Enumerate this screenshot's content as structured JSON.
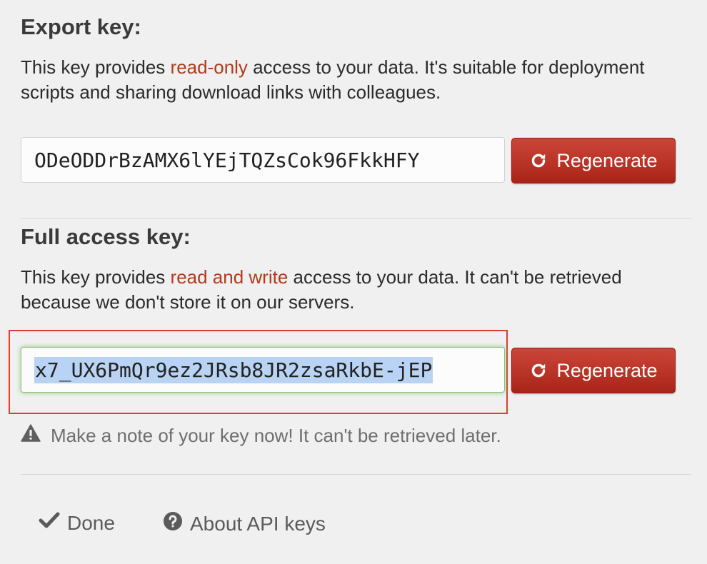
{
  "export_key": {
    "title": "Export key:",
    "desc_before": "This key provides ",
    "desc_highlight": "read-only",
    "desc_after": " access to your data. It's suitable for deployment scripts and sharing download links with colleagues.",
    "value": "ODeODDrBzAMX6lYEjTQZsCok96FkkHFY",
    "regenerate_label": "Regenerate"
  },
  "full_access_key": {
    "title": "Full access key:",
    "desc_before": "This key provides ",
    "desc_highlight": "read and write",
    "desc_after": " access to your data. It can't be retrieved because we don't store it on our servers.",
    "value": "x7_UX6PmQr9ez2JRsb8JR2zsaRkbE-jEP",
    "regenerate_label": "Regenerate"
  },
  "warning": {
    "icon": "warning-icon",
    "text": "Make a note of your key now! It can't be retrieved later."
  },
  "footer": {
    "done_icon": "checkmark-icon",
    "done_label": "Done",
    "about_icon": "question-circle-icon",
    "about_label": "About API keys"
  },
  "colors": {
    "highlight_text": "#b5391b",
    "button_red": "#b8301f",
    "annotation_box": "#d9402f",
    "selection": "#b8d3f4"
  }
}
